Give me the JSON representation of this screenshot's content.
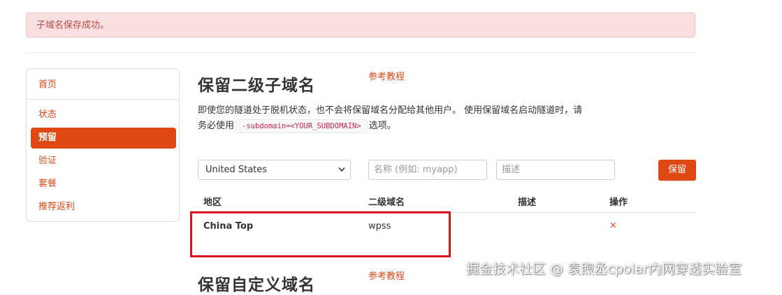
{
  "alert": {
    "message": "子域名保存成功。"
  },
  "sidebar": {
    "items": [
      {
        "label": "首页",
        "active": false
      },
      {
        "label": "状态",
        "active": false
      },
      {
        "label": "预留",
        "active": true
      },
      {
        "label": "验证",
        "active": false
      },
      {
        "label": "套餐",
        "active": false
      },
      {
        "label": "推荐返利",
        "active": false
      }
    ]
  },
  "section1": {
    "title": "保留二级子域名",
    "ref_link": "参考教程",
    "desc_part1": "即使您的隧道处于脱机状态，也不会将保留域名分配给其他用户。 使用保留域名启动隧道时，请务必使用",
    "code": "-subdomain=<YOUR_SUBDOMAIN>",
    "desc_part2": "选项。"
  },
  "form": {
    "region_selected": "United States",
    "name_placeholder": "名称 (例如: myapp)",
    "desc_placeholder": "描述",
    "save_label": "保留"
  },
  "table": {
    "headers": [
      "地区",
      "二级域名",
      "描述",
      "操作"
    ],
    "rows": [
      {
        "region": "China Top",
        "subdomain": "wpss",
        "description": "",
        "action": "×"
      }
    ]
  },
  "section2": {
    "title": "保留自定义域名",
    "ref_link": "参考教程"
  },
  "watermark": "掘金技术社区 @ 袁煦丞cpolar内网穿透实验室",
  "colors": {
    "accent": "#dd4814",
    "alert_bg": "#f9dfdf",
    "alert_text": "#b94a48",
    "highlight_box": "#d9141e"
  }
}
